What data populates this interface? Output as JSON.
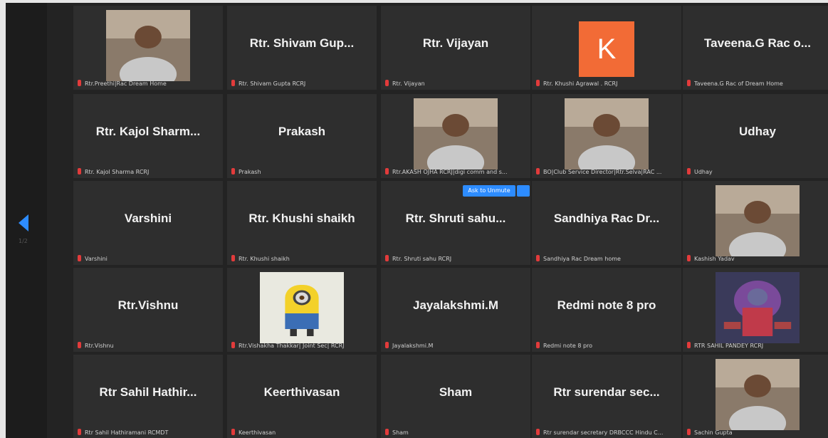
{
  "nav": {
    "page_indicator": "1/2"
  },
  "ask_to_unmute": "Ask to Unmute",
  "participants": [
    {
      "display": "",
      "label": "Rtr.Preethi|Rac Dream Home",
      "video": true,
      "avatar": "person-photo"
    },
    {
      "display": "Rtr. Shivam Gup...",
      "label": "Rtr. Shivam Gupta RCRJ"
    },
    {
      "display": "Rtr. Vijayan",
      "label": "Rtr. Vijayan"
    },
    {
      "display": "K",
      "label": "Rtr. Khushi Agrawal . RCRJ",
      "avatar_letter": true,
      "avatar_color": "#f26b36"
    },
    {
      "display": "Taveena.G Rac o...",
      "label": "Taveena.G Rac of Dream Home"
    },
    {
      "display": "Rtr. Kajol Sharm...",
      "label": "Rtr. Kajol Sharma RCRJ"
    },
    {
      "display": "Prakash",
      "label": "Prakash"
    },
    {
      "display": "",
      "label": "Rtr.AKASH OJHA RCRJ|digi comm and s...",
      "video": true,
      "avatar": "person-photo"
    },
    {
      "display": "",
      "label": "BO|Club Service Director|Rtr.Selva|RAC ...",
      "video": true,
      "avatar": "person-photo"
    },
    {
      "display": "Udhay",
      "label": "Udhay"
    },
    {
      "display": "Varshini",
      "label": "Varshini"
    },
    {
      "display": "Rtr. Khushi shaikh",
      "label": "Rtr. Khushi shaikh"
    },
    {
      "display": "Rtr. Shruti sahu...",
      "label": "Rtr. Shruti sahu RCRJ"
    },
    {
      "display": "Sandhiya Rac Dr...",
      "label": "Sandhiya Rac Dream home"
    },
    {
      "display": "",
      "label": "Kashish Yadav",
      "video": true,
      "avatar": "person-photo"
    },
    {
      "display": "Rtr.Vishnu",
      "label": "Rtr.Vishnu"
    },
    {
      "display": "",
      "label": "Rtr.Vishakha Thakkar| Joint Sec| RCRJ",
      "video": true,
      "avatar": "minion-image"
    },
    {
      "display": "Jayalakshmi.M",
      "label": "Jayalakshmi.M"
    },
    {
      "display": "Redmi note 8 pro",
      "label": "Redmi note 8 pro"
    },
    {
      "display": "",
      "label": "RTR SAHIL PANDEY RCRJ",
      "video": true,
      "avatar": "deity-image"
    },
    {
      "display": "Rtr Sahil Hathir...",
      "label": "Rtr Sahil Hathiramani RCMDT"
    },
    {
      "display": "Keerthivasan",
      "label": "Keerthivasan"
    },
    {
      "display": "Sham",
      "label": "Sham"
    },
    {
      "display": "Rtr surendar sec...",
      "label": "Rtr surendar secretary DRBCCC Hindu C..."
    },
    {
      "display": "",
      "label": "Sachin Gupta",
      "video": true,
      "avatar": "person-photo"
    }
  ],
  "colors": {
    "background": "#232323",
    "tile": "#2e2e2e",
    "accent": "#2d8cff",
    "mic_muted": "#e23b3b"
  }
}
